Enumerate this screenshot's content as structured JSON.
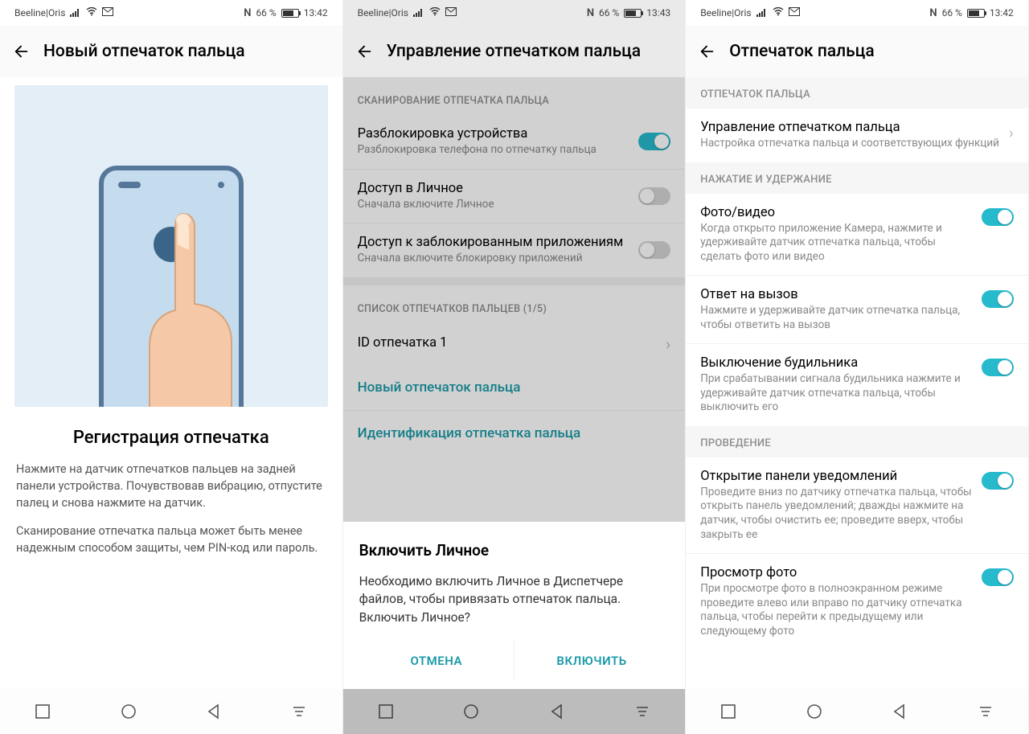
{
  "status": {
    "carrier": "Beeline|Oris",
    "nfc": "ℕ",
    "battery": "66 %",
    "time1": "13:42",
    "time2": "13:43",
    "time3": "13:42"
  },
  "s1": {
    "header": "Новый отпечаток пальца",
    "title": "Регистрация отпечатка",
    "p1": "Нажмите на датчик отпечатков пальцев на зад­ней панели устройства. Почувствовав вибрацию, отпустите палец и снова нажмите на датчик.",
    "p2": "Сканирование отпечатка пальца может быть менее надежным способом защиты, чем PIN-код или пароль."
  },
  "s2": {
    "header": "Управление отпечатком пальца",
    "section1": "СКАНИРОВАНИЕ ОТПЕЧАТКА ПАЛЬЦА",
    "row1_t": "Разблокировка устройства",
    "row1_s": "Разблокировка телефона по отпечатку пальца",
    "row2_t": "Доступ в Личное",
    "row2_s": "Сначала включите Личное",
    "row3_t": "Доступ к заблокированным приложениям",
    "row3_s": "Сначала включите блокировку приложений",
    "section2": "СПИСОК ОТПЕЧАТКОВ ПАЛЬЦЕВ (1/5)",
    "row4_t": "ID отпечатка 1",
    "link1": "Новый отпечаток пальца",
    "link2": "Идентификация отпечатка пальца",
    "dialog_title": "Включить Личное",
    "dialog_body": "Необходимо включить Личное в Диспетчере файлов, чтобы привязать отпечаток пальца. Включить Личное?",
    "dialog_cancel": "ОТМЕНА",
    "dialog_ok": "ВКЛЮЧИТЬ"
  },
  "s3": {
    "header": "Отпечаток пальца",
    "section1": "ОТПЕЧАТОК ПАЛЬЦА",
    "row1_t": "Управление отпечатком пальца",
    "row1_s": "Настройка отпечатка пальца и соответствующих функций",
    "section2": "НАЖАТИЕ И УДЕРЖАНИЕ",
    "row2_t": "Фото/видео",
    "row2_s": "Когда открыто приложение Камера, нажмите и удерживайте датчик отпечатка пальца, чтобы сделать фото или видео",
    "row3_t": "Ответ на вызов",
    "row3_s": "Нажмите и удерживайте датчик отпечатка пальца, чтобы ответить на вызов",
    "row4_t": "Выключение будильника",
    "row4_s": "При срабатывании сигнала будильника нажмите и удерживайте датчик отпечатка пальца, чтобы выключить его",
    "section3": "ПРОВЕДЕНИЕ",
    "row5_t": "Открытие панели уведомлений",
    "row5_s": "Проведите вниз по датчику отпечатка пальца, чтобы открыть панель уведомлений; дважды нажмите на датчик, чтобы очистить ее; проведите вверх, чтобы закрыть ее",
    "row6_t": "Просмотр фото",
    "row6_s": "При просмотре фото в полноэкранном режиме проведите влево или вправо по датчику отпечатка пальца, чтобы перейти к предыдущему или следующему фото"
  }
}
